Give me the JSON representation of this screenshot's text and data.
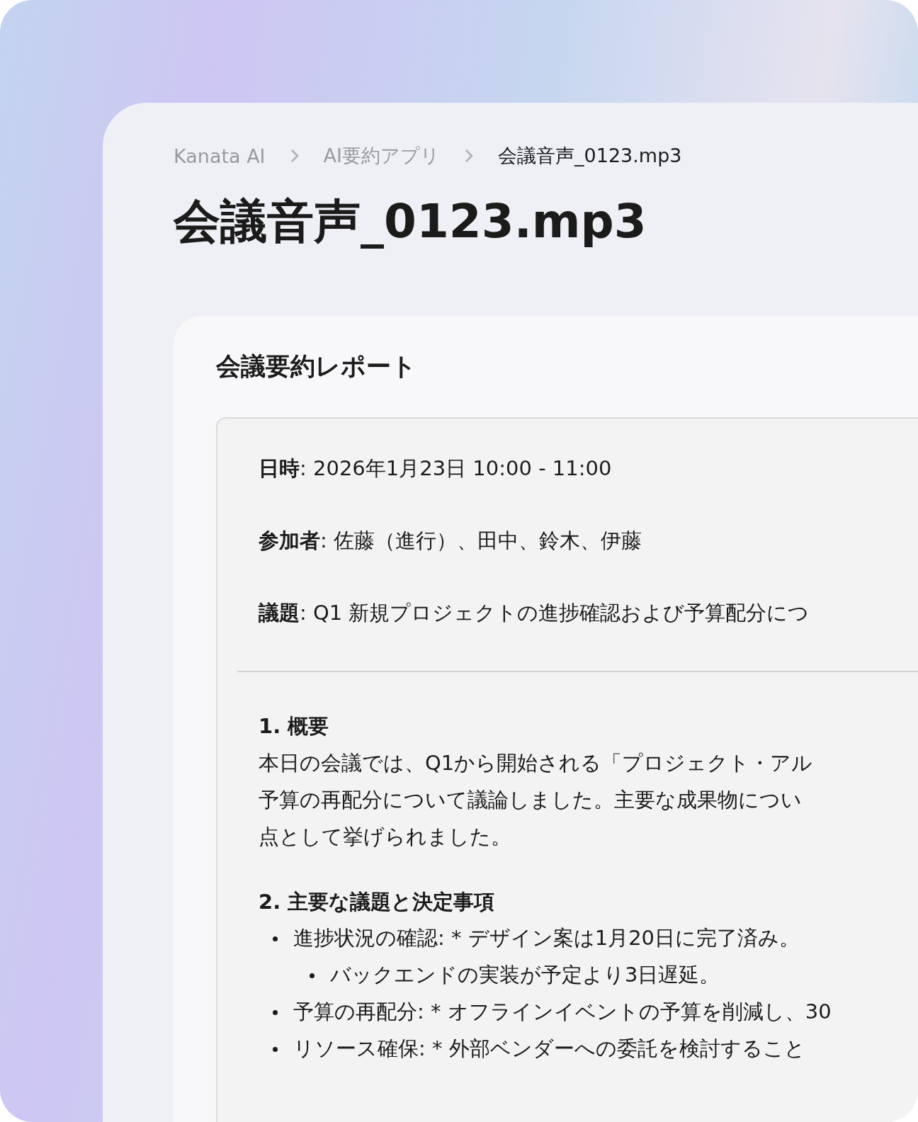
{
  "breadcrumb": [
    {
      "label": "Kanata AI",
      "current": false
    },
    {
      "label": "AI要約アプリ",
      "current": false
    },
    {
      "label": "会議音声_0123.mp3",
      "current": true
    }
  ],
  "title": "会議音声_0123.mp3",
  "card": {
    "title": "会議要約レポート",
    "meta": [
      "**日時**: 2026年1月23日 10:00 - 11:00",
      "**参加者**: 佐藤（進行）、田中、鈴木、伊藤",
      "**議題**: Q1 新規プロジェクトの進捗確認および予算配分につ"
    ],
    "sections": [
      {
        "heading": "1. 概要",
        "lines": [
          "本日の会議では、Q1から開始される「プロジェクト・アル",
          "予算の再配分について議論しました。主要な成果物につい",
          "点として挙げられました。"
        ]
      },
      {
        "heading": "2. 主要な議題と決定事項",
        "bullets": [
          {
            "text": "進捗状況の確認: * デザイン案は1月20日に完了済み。",
            "children": [
              {
                "text": "バックエンドの実装が予定より3日遅延。"
              }
            ]
          },
          {
            "text": "予算の再配分: * オフラインイベントの予算を削減し、30"
          },
          {
            "text": "リソース確保: * 外部ベンダーへの委託を検討すること"
          }
        ]
      }
    ]
  }
}
